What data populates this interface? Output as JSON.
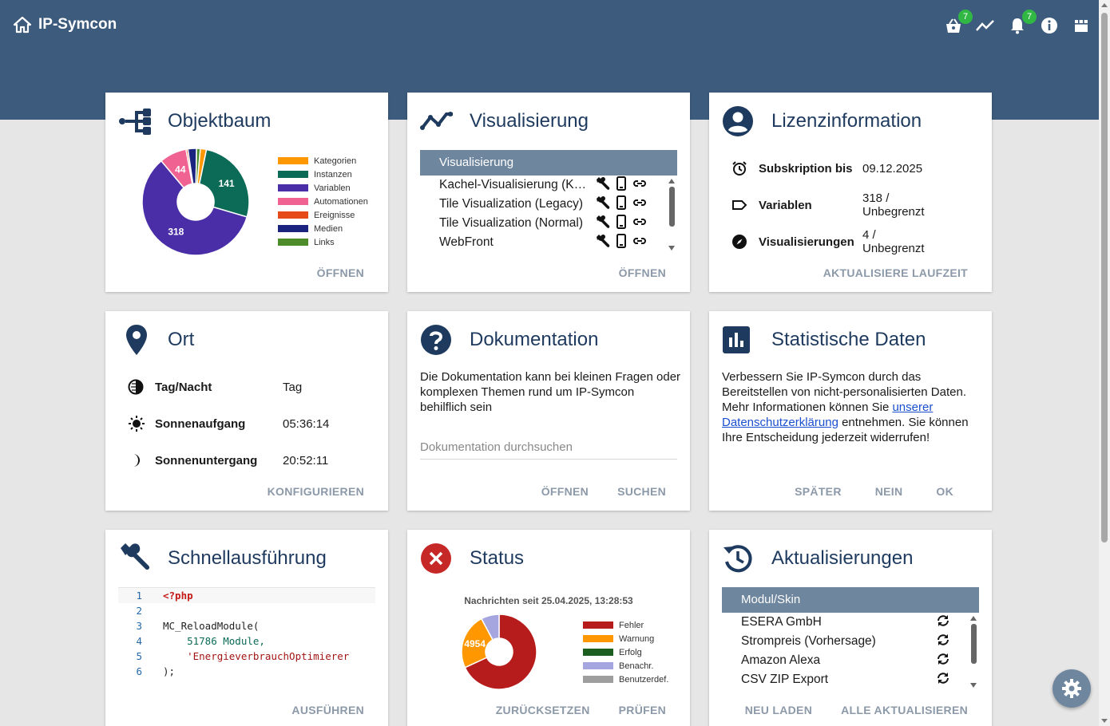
{
  "app": {
    "title": "IP-Symcon"
  },
  "topbar": {
    "basket_badge": "7",
    "bell_badge": "7"
  },
  "colors": {
    "header": "#3d5b7d",
    "title": "#1e3a5f",
    "action": "#8c99a8",
    "table_head": "#6f869f"
  },
  "objektbaum": {
    "title": "Objektbaum",
    "action": "ÖFFNEN",
    "chart_data": {
      "type": "pie",
      "categories": [
        "Kategorien",
        "Instanzen",
        "Variablen",
        "Automationen",
        "Ereignisse",
        "Medien",
        "Links"
      ],
      "values": [
        10,
        141,
        318,
        44,
        3,
        14,
        6
      ],
      "colors": [
        "#ff9800",
        "#0b6b57",
        "#4a2ea8",
        "#f06292",
        "#e64a19",
        "#1a237e",
        "#4c8c2b"
      ],
      "labels_shown": [
        "141",
        "318",
        "44"
      ]
    }
  },
  "visualisierung": {
    "title": "Visualisierung",
    "table_head": "Visualisierung",
    "items": [
      "Kachel-Visualisierung (Kachel)",
      "Tile Visualization (Legacy)",
      "Tile Visualization (Normal)",
      "WebFront"
    ],
    "action": "ÖFFNEN"
  },
  "lizenz": {
    "title": "Lizenzinformation",
    "rows": [
      {
        "icon": "alarm-clock-icon",
        "key": "Subskription bis",
        "value": "09.12.2025"
      },
      {
        "icon": "label-icon",
        "key": "Variablen",
        "value": "318 / Unbegrenzt"
      },
      {
        "icon": "compass-icon",
        "key": "Visualisierungen",
        "value": "4 / Unbegrenzt"
      }
    ],
    "action": "AKTUALISIERE LAUFZEIT"
  },
  "ort": {
    "title": "Ort",
    "rows": [
      {
        "icon": "day-night-icon",
        "key": "Tag/Nacht",
        "value": "Tag"
      },
      {
        "icon": "sun-icon",
        "key": "Sonnenaufgang",
        "value": "05:36:14"
      },
      {
        "icon": "moon-icon",
        "key": "Sonnenuntergang",
        "value": "20:52:11"
      }
    ],
    "action": "KONFIGURIEREN"
  },
  "dokumentation": {
    "title": "Dokumentation",
    "text": "Die Dokumentation kann bei kleinen Fragen oder komplexen Themen rund um IP-Symcon behilflich sein",
    "search_placeholder": "Dokumentation durchsuchen",
    "actions": [
      "ÖFFNEN",
      "SUCHEN"
    ]
  },
  "statistik": {
    "title": "Statistische Daten",
    "text_before": "Verbessern Sie IP-Symcon durch das Bereitstellen von nicht-personalisierten Daten. Mehr Informationen können Sie",
    "link": "unserer Datenschutzerklärung",
    "text_after": "entnehmen. Sie können Ihre Entscheidung jederzeit widerrufen!",
    "actions": [
      "SPÄTER",
      "NEIN",
      "OK"
    ]
  },
  "schnell": {
    "title": "Schnellausführung",
    "lines": [
      {
        "n": "1",
        "code": "<?php"
      },
      {
        "n": "2",
        "code": ""
      },
      {
        "n": "3",
        "code": "MC_ReloadModule("
      },
      {
        "n": "4",
        "code": "    51786 Module,"
      },
      {
        "n": "5",
        "code": "    'EnergieverbrauchOptimierer"
      },
      {
        "n": "6",
        "code": ");"
      }
    ],
    "action": "AUSFÜHREN"
  },
  "status": {
    "title": "Status",
    "subtitle": "Nachrichten seit 25.04.2025, 13:28:53",
    "chart_data": {
      "type": "pie",
      "categories": [
        "Fehler",
        "Warnung",
        "Erfolg",
        "Benachr.",
        "Benutzerdef."
      ],
      "values": [
        14000,
        4954,
        0,
        1600,
        0
      ],
      "colors": [
        "#b71c1c",
        "#ff9800",
        "#1b5e20",
        "#a5a5e0",
        "#9e9e9e"
      ],
      "labels_shown": [
        "4954"
      ]
    },
    "actions": [
      "ZURÜCKSETZEN",
      "PRÜFEN"
    ]
  },
  "updates": {
    "title": "Aktualisierungen",
    "table_head": "Modul/Skin",
    "items": [
      "ESERA GmbH",
      "Strompreis (Vorhersage)",
      "Amazon Alexa",
      "CSV ZIP Export"
    ],
    "actions": [
      "NEU LADEN",
      "ALLE AKTUALISIEREN"
    ]
  }
}
